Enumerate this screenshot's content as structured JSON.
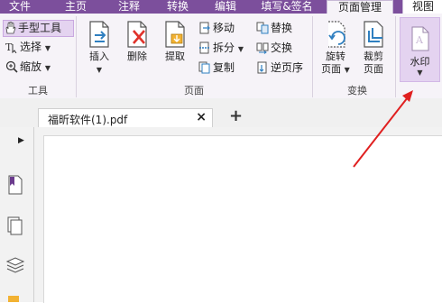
{
  "menubar": {
    "tabs": [
      "文件",
      "主页",
      "注释",
      "转换",
      "编辑",
      "填写&签名",
      "页面管理",
      "视图"
    ],
    "active": "页面管理"
  },
  "ribbon": {
    "tools": {
      "hand_tool": "手型工具",
      "select": "选择",
      "zoom": "缩放",
      "group_label": "工具"
    },
    "pages": {
      "insert": "插入",
      "delete": "删除",
      "extract": "提取",
      "move": "移动",
      "split": "拆分",
      "copy": "复制",
      "replace": "替换",
      "swap": "交换",
      "reverse": "逆页序",
      "group_label": "页面"
    },
    "transform": {
      "rotate_line1": "旋转",
      "rotate_line2": "页面",
      "crop_line1": "裁剪",
      "crop_line2": "页面",
      "group_label": "变换"
    },
    "watermark": "水印"
  },
  "document": {
    "tab_title": "福昕软件(1).pdf",
    "close_glyph": "×",
    "new_tab_glyph": "+"
  },
  "colors": {
    "menubar": "#7c4f9c",
    "ribbon_bg": "#f6f3f8",
    "highlight": "#e4d3f0",
    "annotation_arrow": "#e02020",
    "sidebar_icon": "#6a3a8c"
  }
}
